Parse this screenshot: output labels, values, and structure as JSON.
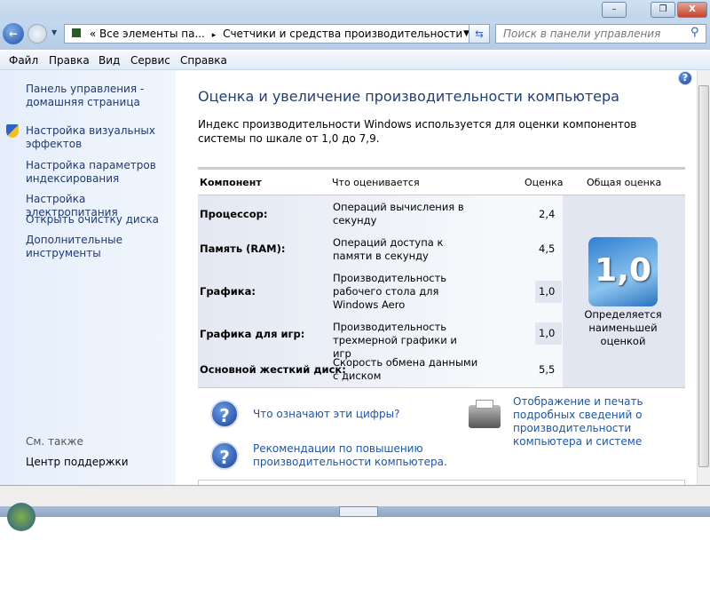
{
  "window": {
    "minimize": "–",
    "restore": "❐",
    "close": "X"
  },
  "address": {
    "prefix": "«",
    "crumb1": "Все элементы па...",
    "sep": "▸",
    "crumb2": "Счетчики и средства производительности"
  },
  "search": {
    "placeholder": "Поиск в панели управления"
  },
  "menu": [
    "Файл",
    "Правка",
    "Вид",
    "Сервис",
    "Справка"
  ],
  "sidebar": {
    "items": [
      "Панель управления - домашняя страница",
      "Настройка визуальных эффектов",
      "Настройка параметров индексирования",
      "Настройка электропитания",
      "Открыть очистку диска",
      "Дополнительные инструменты"
    ],
    "see_also": "См. также",
    "support": "Центр поддержки"
  },
  "main": {
    "title": "Оценка и увеличение производительности компьютера",
    "intro": "Индекс производительности Windows используется для оценки компонентов системы по шкале от 1,0 до 7,9.",
    "headers": [
      "Компонент",
      "Что оценивается",
      "Оценка",
      "Общая оценка"
    ],
    "rows": [
      {
        "component": "Процессор:",
        "what": "Операций вычисления в секунду",
        "score": "2,4"
      },
      {
        "component": "Память (RAM):",
        "what": "Операций доступа к памяти в секунду",
        "score": "4,5"
      },
      {
        "component": "Графика:",
        "what": "Производительность рабочего стола для Windows Aero",
        "score": "1,0"
      },
      {
        "component": "Графика для игр:",
        "what": "Производительность трехмерной графики и игр",
        "score": "1,0"
      },
      {
        "component": "Основной жесткий диск:",
        "what": "Скорость обмена данными с диском",
        "score": "5,5"
      }
    ],
    "base_score": "1,0",
    "base_note": "Определяется наименьшей оценкой",
    "links": {
      "what_mean": "Что означают эти цифры?",
      "print": "Отображение и печать подробных сведений о производительности компьютера и системе",
      "tips": "Рекомендации по повышению производительности компьютера."
    },
    "help": "?"
  },
  "colors": {
    "link": "#1e56a6",
    "title": "#1e3f7a",
    "table_bg": "#e3e8f2"
  }
}
